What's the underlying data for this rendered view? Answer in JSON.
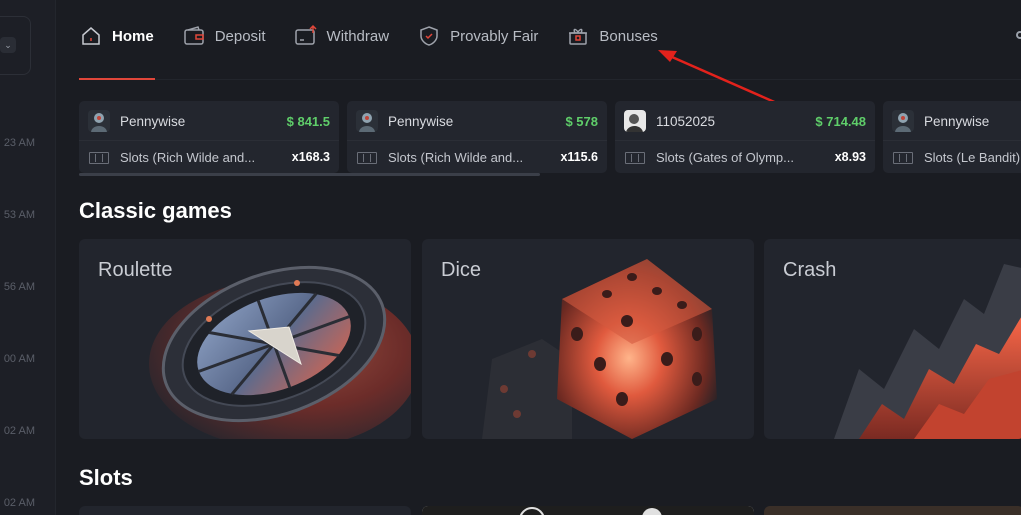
{
  "sidebar": {
    "times": [
      "23 AM",
      "53 AM",
      "56 AM",
      "00 AM",
      "02 AM",
      "02 AM"
    ]
  },
  "nav": {
    "items": [
      {
        "label": "Home",
        "icon": "home-icon",
        "active": true
      },
      {
        "label": "Deposit",
        "icon": "wallet-icon",
        "active": false
      },
      {
        "label": "Withdraw",
        "icon": "withdraw-icon",
        "active": false
      },
      {
        "label": "Provably Fair",
        "icon": "shield-check-icon",
        "active": false
      },
      {
        "label": "Bonuses",
        "icon": "gift-icon",
        "active": false
      }
    ]
  },
  "live_bets": [
    {
      "user": "Pennywise",
      "amount": "$ 841.5",
      "game": "Slots (Rich Wilde and...",
      "multiplier": "x168.3"
    },
    {
      "user": "Pennywise",
      "amount": "$ 578",
      "game": "Slots (Rich Wilde and...",
      "multiplier": "x115.6"
    },
    {
      "user": "11052025",
      "amount": "$ 714.48",
      "game": "Slots (Gates of Olymp...",
      "multiplier": "x8.93"
    },
    {
      "user": "Pennywise",
      "amount": "",
      "game": "Slots (Le Bandit)",
      "multiplier": ""
    }
  ],
  "sections": {
    "classic_title": "Classic games",
    "slots_title": "Slots"
  },
  "classic_games": [
    {
      "label": "Roulette"
    },
    {
      "label": "Dice"
    },
    {
      "label": "Crash"
    }
  ],
  "colors": {
    "accent": "#e0463a",
    "win": "#5fce6a",
    "background": "#1a1c22",
    "card": "#23262e"
  }
}
